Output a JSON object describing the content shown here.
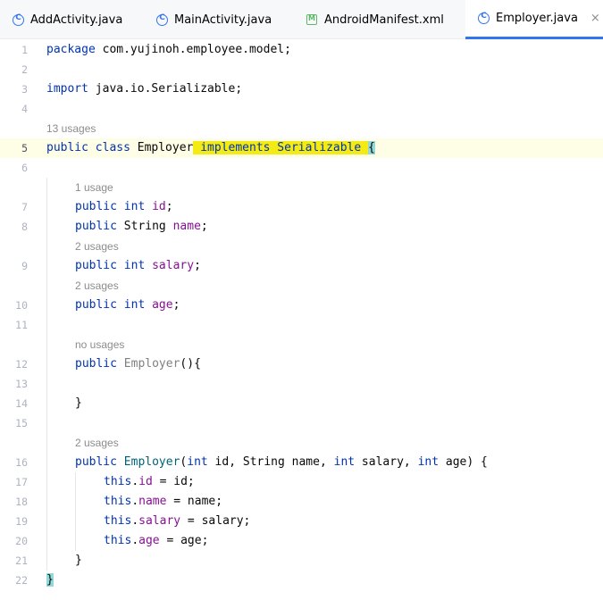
{
  "tabs": [
    {
      "label": "AddActivity.java",
      "icon": "class-icon",
      "active": false
    },
    {
      "label": "MainActivity.java",
      "icon": "class-icon",
      "active": false
    },
    {
      "label": "AndroidManifest.xml",
      "icon": "manifest-icon",
      "active": false
    },
    {
      "label": "Employer.java",
      "icon": "class-icon",
      "active": true
    }
  ],
  "close_glyph": "×",
  "gutter": {
    "current_line": "5"
  },
  "lines": {
    "1": {
      "number": "1",
      "kw": "package",
      "rest": " com.yujinoh.employee.model;"
    },
    "2": {
      "number": "2"
    },
    "3": {
      "number": "3",
      "kw": "import",
      "rest": " java.io.Serializable;"
    },
    "4": {
      "number": "4"
    },
    "5": {
      "number": "5",
      "kw1": "public class",
      "name": " Employer",
      "impl": " implements Serializable ",
      "brace": "{"
    },
    "6": {
      "number": "6"
    },
    "7": {
      "number": "7",
      "kw": "public int",
      "field": "id",
      "end": ";"
    },
    "8": {
      "number": "8",
      "kw": "public",
      "type": " String ",
      "field": "name",
      "end": ";"
    },
    "9": {
      "number": "9",
      "kw": "public int",
      "field": "salary",
      "end": ";"
    },
    "10": {
      "number": "10",
      "kw": "public int",
      "field": "age",
      "end": ";"
    },
    "11": {
      "number": "11"
    },
    "12": {
      "number": "12",
      "kw": "public",
      "ctor": "Employer",
      "end": "(){"
    },
    "13": {
      "number": "13"
    },
    "14": {
      "number": "14",
      "text": "}"
    },
    "15": {
      "number": "15"
    },
    "16": {
      "number": "16",
      "kw": "public",
      "ctor": "Employer",
      "p1": "(",
      "k1": "int",
      "t1": " id, String name, ",
      "k2": "int",
      "t2": " salary, ",
      "k3": "int",
      "t3": " age) {"
    },
    "17": {
      "number": "17",
      "kw": "this",
      "dot": ".",
      "field": "id",
      "rest": " = id;"
    },
    "18": {
      "number": "18",
      "kw": "this",
      "dot": ".",
      "field": "name",
      "rest": " = name;"
    },
    "19": {
      "number": "19",
      "kw": "this",
      "dot": ".",
      "field": "salary",
      "rest": " = salary;"
    },
    "20": {
      "number": "20",
      "kw": "this",
      "dot": ".",
      "field": "age",
      "rest": " = age;"
    },
    "21": {
      "number": "21",
      "text": "}"
    },
    "22": {
      "number": "22",
      "brace": "}"
    }
  },
  "hints": {
    "class_usages": "13 usages",
    "id_usages": "1 usage",
    "salary_usages": "2 usages",
    "age_usages": "2 usages",
    "ctor1_usages": "no usages",
    "ctor2_usages": "2 usages"
  },
  "colors": {
    "keyword": "#0033b3",
    "field": "#871094",
    "constructor": "#00627a",
    "highlight": "#f5eb14",
    "brace_match": "#93d9d9",
    "current_line": "#fefde6",
    "tab_active_underline": "#3574f0"
  }
}
